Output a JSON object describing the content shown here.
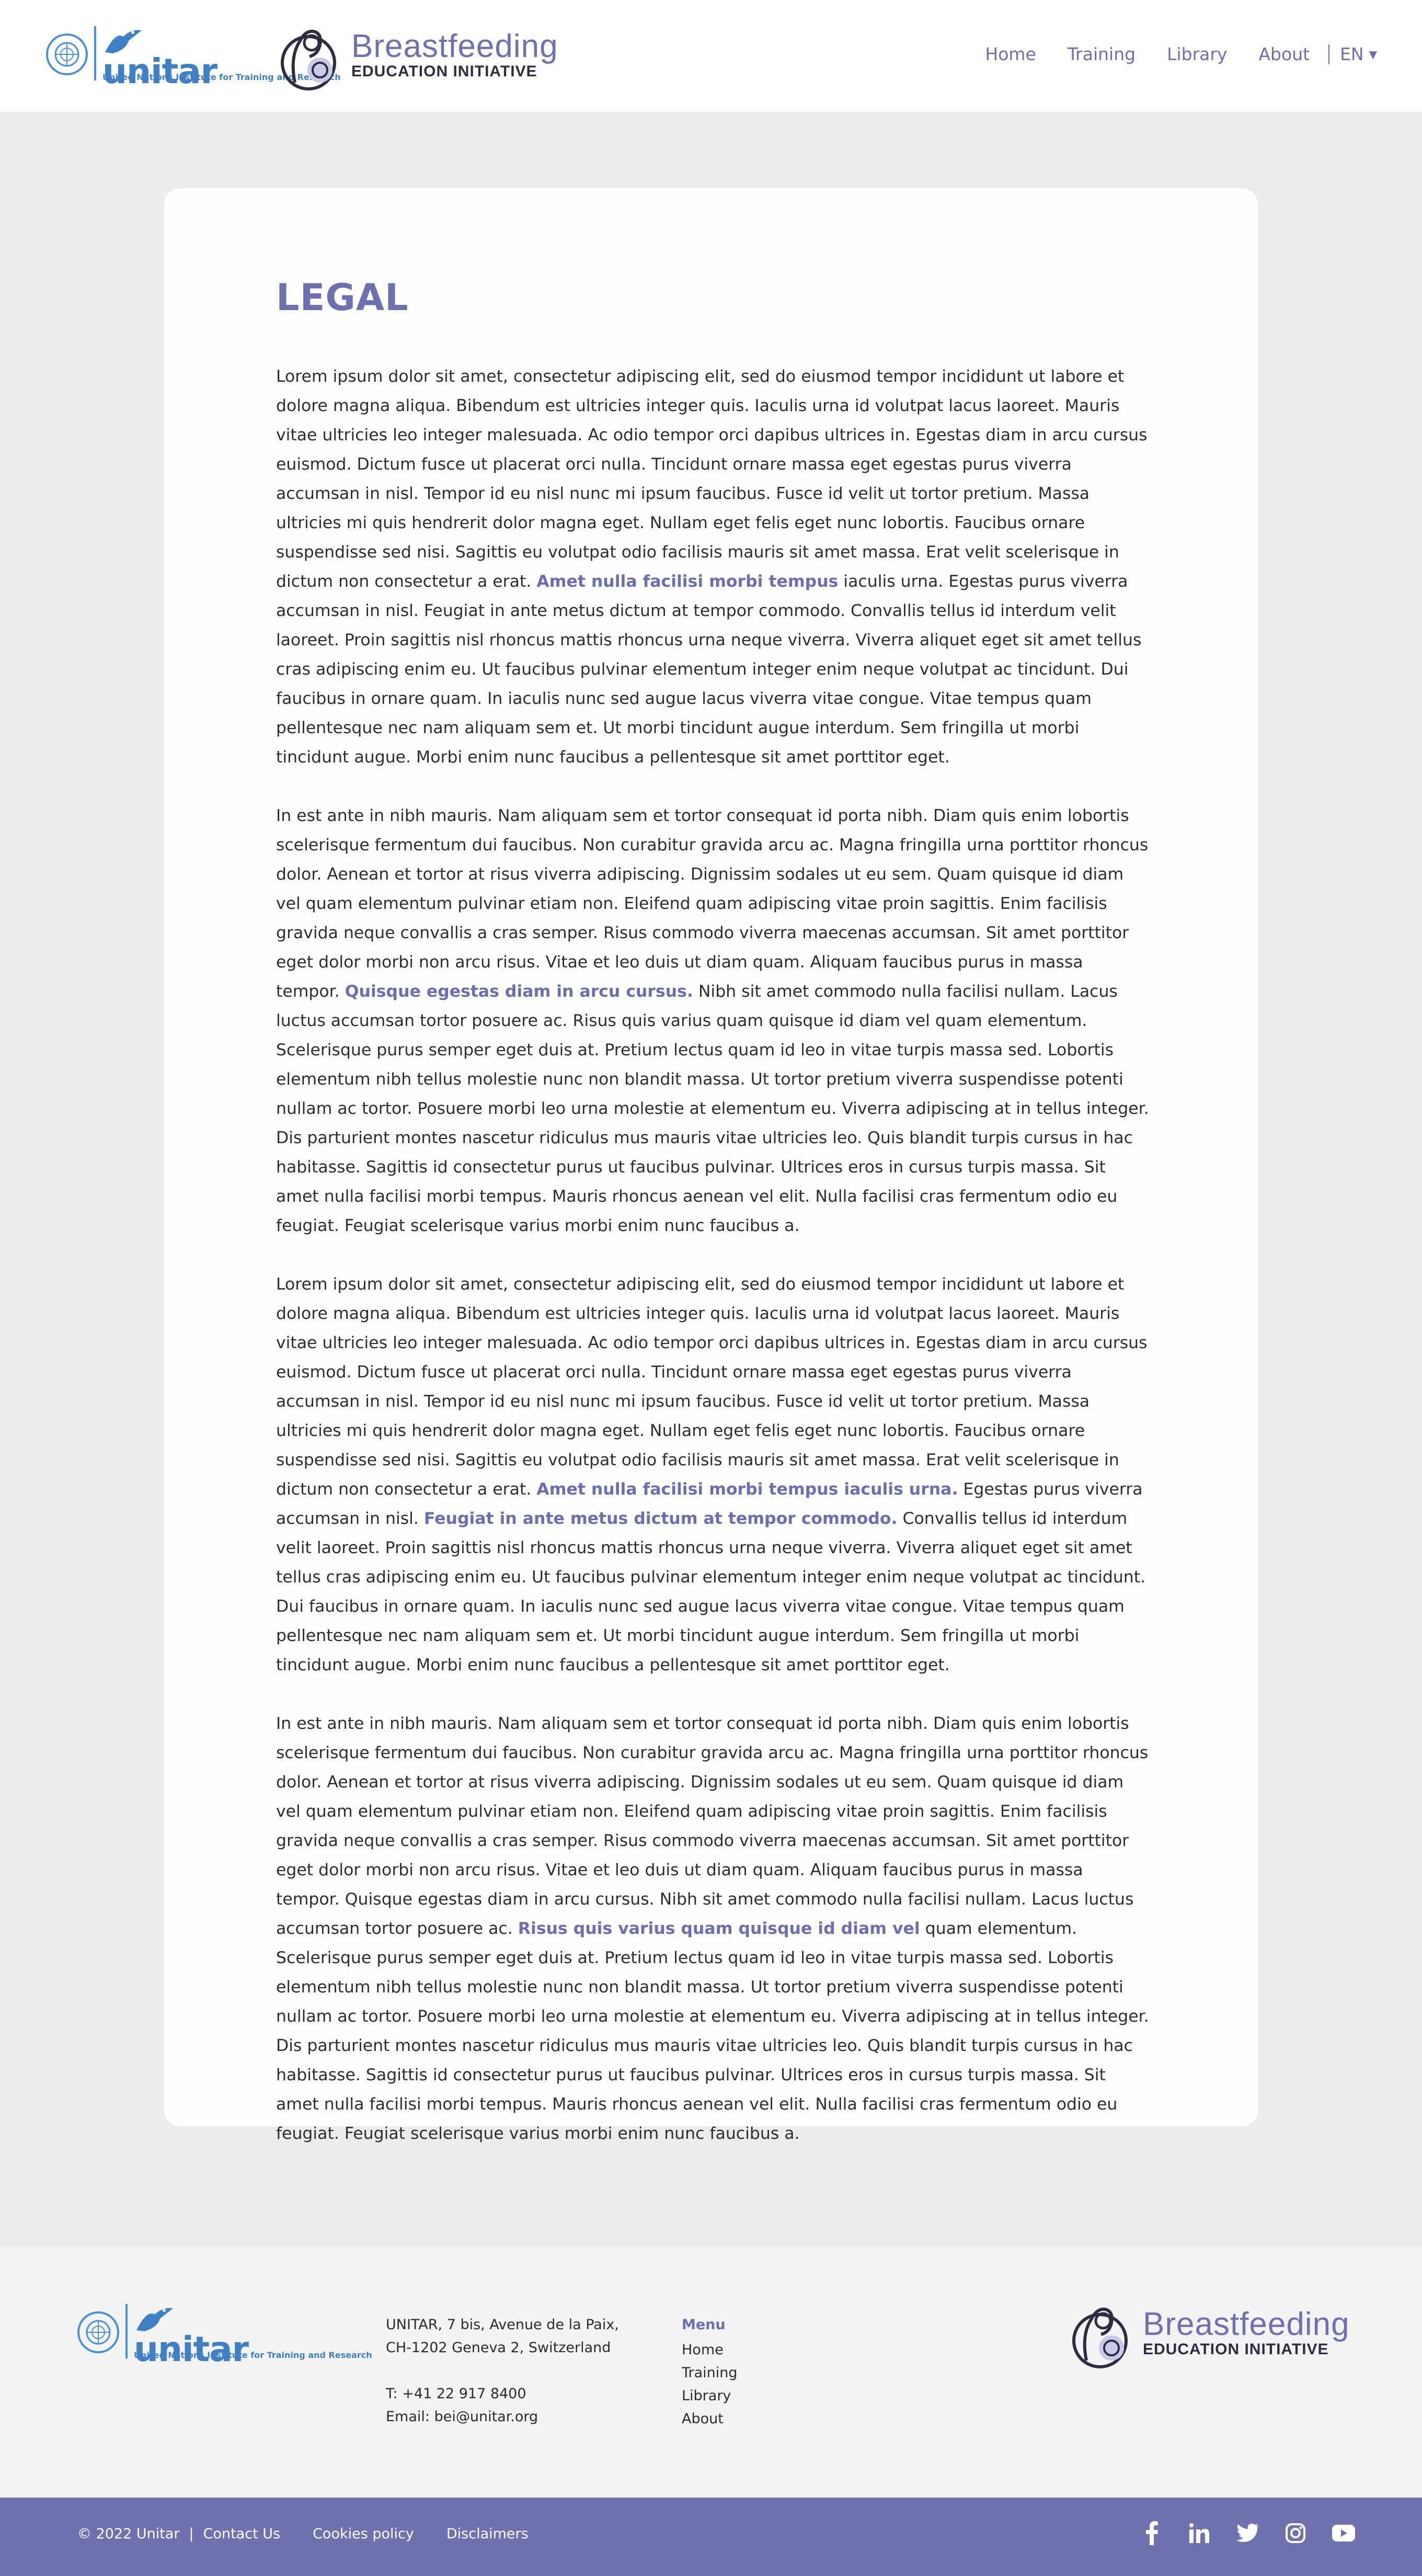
{
  "header": {
    "un_logo": {
      "icon": "un-emblem-icon",
      "word": "unitar",
      "subtitle": "United Nations Institute for Training and Research"
    },
    "bei_logo": {
      "icon": "mother-child-icon",
      "title": "Breastfeeding",
      "subtitle": "EDUCATION INITIATIVE"
    },
    "nav": [
      "Home",
      "Training",
      "Library",
      "About"
    ],
    "language": "EN"
  },
  "page": {
    "title": "LEGAL",
    "paragraphs": [
      {
        "a": "Lorem ipsum dolor sit amet, consectetur adipiscing elit, sed do eiusmod tempor incididunt ut labore et dolore magna aliqua. Bibendum est ultricies integer quis. Iaculis urna id volutpat lacus laoreet. Mauris vitae ultricies leo integer malesuada. Ac odio tempor orci dapibus ultrices in. Egestas diam in arcu cursus euismod. Dictum fusce ut placerat orci nulla. Tincidunt ornare massa eget egestas purus viverra accumsan in nisl. Tempor id eu nisl nunc mi ipsum faucibus. Fusce id velit ut tortor pretium. Massa ultricies mi quis hendrerit dolor magna eget. Nullam eget felis eget nunc lobortis. Faucibus ornare suspendisse sed nisi. Sagittis eu volutpat odio facilisis mauris sit amet massa. Erat velit scelerisque in dictum non consectetur a erat. ",
        "link1": "Amet nulla facilisi morbi tempus",
        "b": " iaculis urna. Egestas purus viverra accumsan in nisl. Feugiat in ante metus dictum at tempor commodo. Convallis tellus id interdum velit laoreet. Proin sagittis nisl rhoncus mattis rhoncus urna neque viverra. Viverra aliquet eget sit amet tellus cras adipiscing enim eu. Ut faucibus pulvinar elementum integer enim neque volutpat ac tincidunt. Dui faucibus in ornare quam. In iaculis nunc sed augue lacus viverra vitae congue. Vitae tempus quam pellentesque nec nam aliquam sem et. Ut morbi tincidunt augue interdum. Sem fringilla ut morbi tincidunt augue. Morbi enim nunc faucibus a pellentesque sit amet porttitor eget."
      },
      {
        "a": "In est ante in nibh mauris. Nam aliquam sem et tortor consequat id porta nibh. Diam quis enim lobortis scelerisque fermentum dui faucibus. Non curabitur gravida arcu ac. Magna fringilla urna porttitor rhoncus dolor. Aenean et tortor at risus viverra adipiscing. Dignissim sodales ut eu sem. Quam quisque id diam vel quam elementum pulvinar etiam non. Eleifend quam adipiscing vitae proin sagittis. Enim facilisis gravida neque convallis a cras semper. Risus commodo viverra maecenas accumsan. Sit amet porttitor eget dolor morbi non arcu risus. Vitae et leo duis ut diam quam. Aliquam faucibus purus in massa tempor. ",
        "link1": "Quisque egestas diam in arcu cursus.",
        "b": " Nibh sit amet commodo nulla facilisi nullam. Lacus luctus accumsan tortor posuere ac. Risus quis varius quam quisque id diam vel quam elementum. Scelerisque purus semper eget duis at. Pretium lectus quam id leo in vitae turpis massa sed. Lobortis elementum nibh tellus molestie nunc non blandit massa. Ut tortor pretium viverra suspendisse potenti nullam ac tortor. Posuere morbi leo urna molestie at elementum eu. Viverra adipiscing at in tellus integer. Dis parturient montes nascetur ridiculus mus mauris vitae ultricies leo. Quis blandit turpis cursus in hac habitasse. Sagittis id consectetur purus ut faucibus pulvinar. Ultrices eros in cursus turpis massa. Sit amet nulla facilisi morbi tempus. Mauris rhoncus aenean vel elit. Nulla facilisi cras fermentum odio eu feugiat. Feugiat scelerisque varius morbi enim nunc faucibus a."
      },
      {
        "a": "Lorem ipsum dolor sit amet, consectetur adipiscing elit, sed do eiusmod tempor incididunt ut labore et dolore magna aliqua. Bibendum est ultricies integer quis. Iaculis urna id volutpat lacus laoreet. Mauris vitae ultricies leo integer malesuada. Ac odio tempor orci dapibus ultrices in. Egestas diam in arcu cursus euismod. Dictum fusce ut placerat orci nulla. Tincidunt ornare massa eget egestas purus viverra accumsan in nisl. Tempor id eu nisl nunc mi ipsum faucibus. Fusce id velit ut tortor pretium. Massa ultricies mi quis hendrerit dolor magna eget. Nullam eget felis eget nunc lobortis. Faucibus ornare suspendisse sed nisi. Sagittis eu volutpat odio facilisis mauris sit amet massa. Erat velit scelerisque in dictum non consectetur a erat. ",
        "link1": "Amet nulla facilisi morbi tempus iaculis urna.",
        "b": " Egestas purus viverra accumsan in nisl. ",
        "link2": "Feugiat in ante metus dictum at tempor commodo.",
        "c": " Convallis tellus id interdum velit laoreet. Proin sagittis nisl rhoncus mattis rhoncus urna neque viverra. Viverra aliquet eget sit amet tellus cras adipiscing enim eu. Ut faucibus pulvinar elementum integer enim neque volutpat ac tincidunt. Dui faucibus in ornare quam. In iaculis nunc sed augue lacus viverra vitae congue. Vitae tempus quam pellentesque nec nam aliquam sem et. Ut morbi tincidunt augue interdum. Sem fringilla ut morbi tincidunt augue. Morbi enim nunc faucibus a pellentesque sit amet porttitor eget."
      },
      {
        "a": "In est ante in nibh mauris. Nam aliquam sem et tortor consequat id porta nibh. Diam quis enim lobortis scelerisque fermentum dui faucibus. Non curabitur gravida arcu ac. Magna fringilla urna porttitor rhoncus dolor. Aenean et tortor at risus viverra adipiscing. Dignissim sodales ut eu sem. Quam quisque id diam vel quam elementum pulvinar etiam non. Eleifend quam adipiscing vitae proin sagittis. Enim facilisis gravida neque convallis a cras semper. Risus commodo viverra maecenas accumsan. Sit amet porttitor eget dolor morbi non arcu risus. Vitae et leo duis ut diam quam. Aliquam faucibus purus in massa tempor. Quisque egestas diam in arcu cursus. Nibh sit amet commodo nulla facilisi nullam. Lacus luctus accumsan tortor posuere ac. ",
        "link1": "Risus quis varius quam quisque id diam vel",
        "b": " quam elementum. Scelerisque purus semper eget duis at. Pretium lectus quam id leo in vitae turpis massa sed. Lobortis elementum nibh tellus molestie nunc non blandit massa. Ut tortor pretium viverra suspendisse potenti nullam ac tortor. Posuere morbi leo urna molestie at elementum eu. Viverra adipiscing at in tellus integer. Dis parturient montes nascetur ridiculus mus mauris vitae ultricies leo. Quis blandit turpis cursus in hac habitasse. Sagittis id consectetur purus ut faucibus pulvinar. Ultrices eros in cursus turpis massa. Sit amet nulla facilisi morbi tempus. Mauris rhoncus aenean vel elit. Nulla facilisi cras fermentum odio eu feugiat. Feugiat scelerisque varius morbi enim nunc faucibus a."
      }
    ]
  },
  "footer": {
    "address_line1": "UNITAR, 7 bis, Avenue de la Paix,",
    "address_line2": "CH-1202 Geneva 2, Switzerland",
    "phone": "T: +41 22 917 8400",
    "email": "Email: bei@unitar.org",
    "menu_title": "Menu",
    "menu_items": [
      "Home",
      "Training",
      "Library",
      "About"
    ]
  },
  "bottom_bar": {
    "copyright": "© 2022 Unitar",
    "separator": "|",
    "links": [
      "Contact Us",
      "Cookies policy",
      "Disclaimers"
    ],
    "social_icons": [
      "facebook-icon",
      "linkedin-icon",
      "twitter-icon",
      "instagram-icon",
      "youtube-icon"
    ]
  },
  "colors": {
    "accent": "#6b6fb2",
    "un_blue": "#3f7fc6",
    "page_bg": "#ececec",
    "footer_bg": "#f3f3f3",
    "bottom_bar": "#7072b0"
  }
}
